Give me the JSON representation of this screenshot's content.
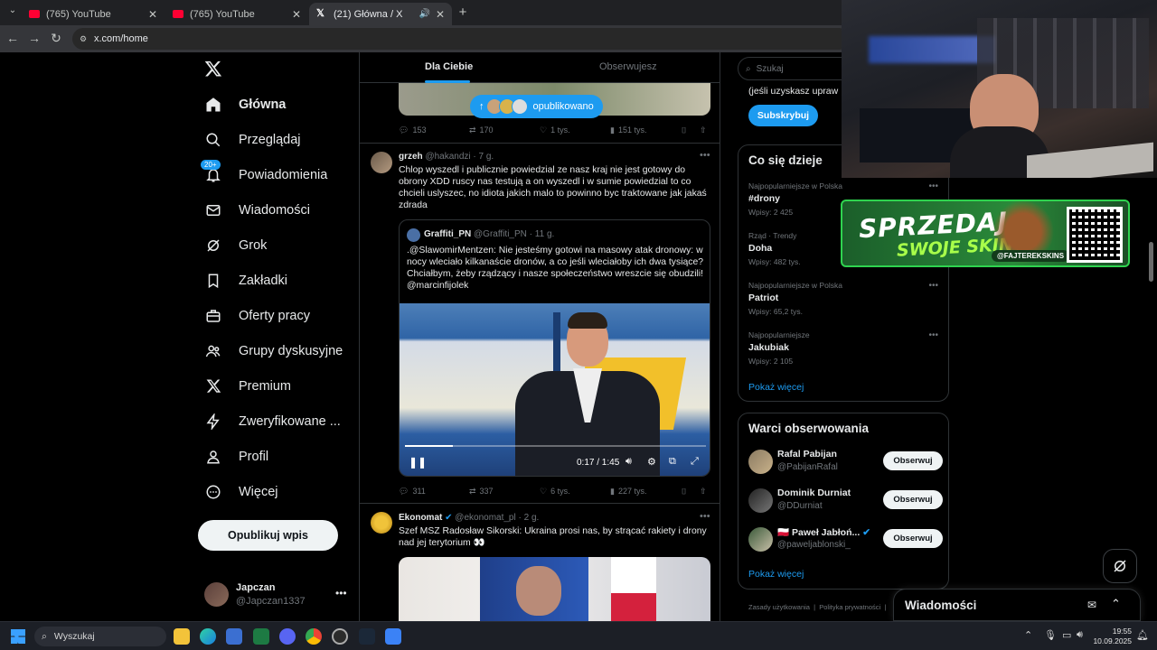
{
  "browser": {
    "tabs": [
      {
        "title": "(765) YouTube",
        "favicon": "youtube-icon"
      },
      {
        "title": "(765) YouTube",
        "favicon": "youtube-icon"
      },
      {
        "title": "(21) Główna / X",
        "favicon": "x-icon"
      }
    ],
    "url": "x.com/home"
  },
  "sidebar": {
    "items": [
      {
        "label": "Główna",
        "icon": "home-icon"
      },
      {
        "label": "Przeglądaj",
        "icon": "search-icon"
      },
      {
        "label": "Powiadomienia",
        "icon": "bell-icon",
        "badge": "20+"
      },
      {
        "label": "Wiadomości",
        "icon": "mail-icon"
      },
      {
        "label": "Grok",
        "icon": "grok-icon"
      },
      {
        "label": "Zakładki",
        "icon": "bookmark-icon"
      },
      {
        "label": "Oferty pracy",
        "icon": "briefcase-icon"
      },
      {
        "label": "Grupy dyskusyjne",
        "icon": "people-icon"
      },
      {
        "label": "Premium",
        "icon": "x-icon"
      },
      {
        "label": "Zweryfikowane ...",
        "icon": "lightning-icon"
      },
      {
        "label": "Profil",
        "icon": "person-icon"
      },
      {
        "label": "Więcej",
        "icon": "more-circle-icon"
      }
    ],
    "post_button": "Opublikuj wpis",
    "account": {
      "name": "Japczan",
      "handle": "@Japczan1337"
    }
  },
  "feed": {
    "tabs": [
      "Dla Ciebie",
      "Obserwujesz"
    ],
    "new_posts_pill": "opublikowano",
    "top_actions": {
      "replies": "153",
      "reposts": "170",
      "likes": "1 tys.",
      "views": "151 tys."
    },
    "tweet1": {
      "name": "grzeh",
      "handle": "@hakandzi",
      "time": "· 7 g.",
      "text": "Chlop wyszedl i publicznie powiedzial ze nasz kraj nie jest gotowy do obrony XDD ruscy nas testują a on wyszedl i w sumie powiedzial to co chcieli uslyszec, no idiota jakich malo to powinno byc traktowane jak jakaś zdrada",
      "quote": {
        "name": "Graffiti_PN",
        "handle": "@Graffiti_PN",
        "time": "· 11 g.",
        "text": ".@SlawomirMentzen: Nie jesteśmy gotowi na masowy atak dronowy: w nocy wleciało kilkanaście dronów, a co jeśli wleciałoby ich dwa tysiące? Chciałbym, żeby rządzący i nasze społeczeństwo wreszcie się obudzili! @marcinfijolek"
      },
      "video": {
        "time": "0:17 / 1:45",
        "progress": 0.16
      },
      "actions": {
        "replies": "311",
        "reposts": "337",
        "likes": "6 tys.",
        "views": "227 tys."
      }
    },
    "tweet2": {
      "name": "Ekonomat",
      "handle": "@ekonomat_pl",
      "time": "· 2 g.",
      "text": "Szef MSZ Radosław Sikorski: Ukraina prosi nas, by strącać rakiety i drony nad jej terytorium 👀"
    }
  },
  "right": {
    "search_placeholder": "Szukaj",
    "premium_text": "(jeśli uzyskasz upraw",
    "subscribe": "Subskrybuj",
    "trends_title": "Co się dzieje",
    "trends": [
      {
        "context": "Najpopularniejsze w Polska",
        "name": "#drony",
        "posts": "Wpisy: 2 425"
      },
      {
        "context": "Rząd · Trendy",
        "name": "Doha",
        "posts": "Wpisy: 482 tys."
      },
      {
        "context": "Najpopularniejsze w Polska",
        "name": "Patriot",
        "posts": "Wpisy: 65,2 tys."
      },
      {
        "context": "Najpopularniejsze",
        "name": "Jakubiak",
        "posts": "Wpisy: 2 105"
      }
    ],
    "show_more": "Pokaż więcej",
    "who_title": "Warci obserwowania",
    "who": [
      {
        "name": "Rafal Pabijan",
        "handle": "@PabijanRafal"
      },
      {
        "name": "Dominik Durniat",
        "handle": "@DDurniat"
      },
      {
        "name": "🇵🇱 Paweł Jabłoń...",
        "handle": "@paweljablonski_"
      }
    ],
    "follow": "Obserwuj",
    "footer": "Zasady użytkowania  |  Polityka prywatności  |"
  },
  "messages_bar": "Wiadomości",
  "banner": {
    "line1": "SPRZEDAJ",
    "line2": "SWOJE SKINY",
    "handle": "@FAJTEREKSKINS"
  },
  "taskbar": {
    "search": "Wyszukaj",
    "time": "19:55",
    "date": "10.09.2025"
  }
}
